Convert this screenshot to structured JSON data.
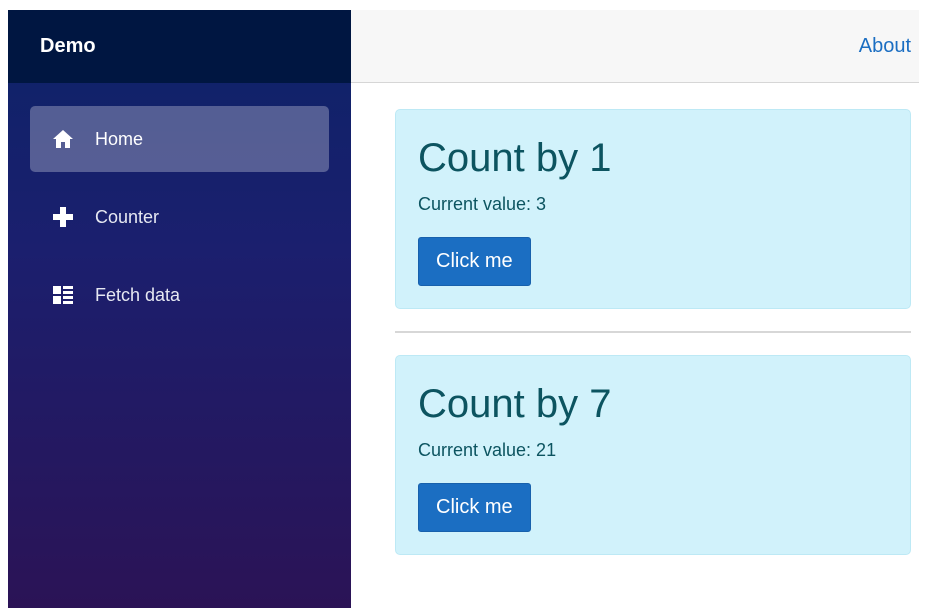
{
  "sidebar": {
    "brand": "Demo",
    "items": [
      {
        "label": "Home",
        "icon": "home-icon",
        "active": true
      },
      {
        "label": "Counter",
        "icon": "plus-icon",
        "active": false
      },
      {
        "label": "Fetch data",
        "icon": "list-icon",
        "active": false
      }
    ]
  },
  "topbar": {
    "about_label": "About"
  },
  "counters": [
    {
      "title": "Count by 1",
      "value_text": "Current value: 3",
      "button_label": "Click me"
    },
    {
      "title": "Count by 7",
      "value_text": "Current value: 21",
      "button_label": "Click me"
    }
  ],
  "colors": {
    "accent": "#1b6ec2",
    "card_bg": "#d1f2fb",
    "card_text": "#0c5460",
    "sidebar_top": "#001641"
  }
}
